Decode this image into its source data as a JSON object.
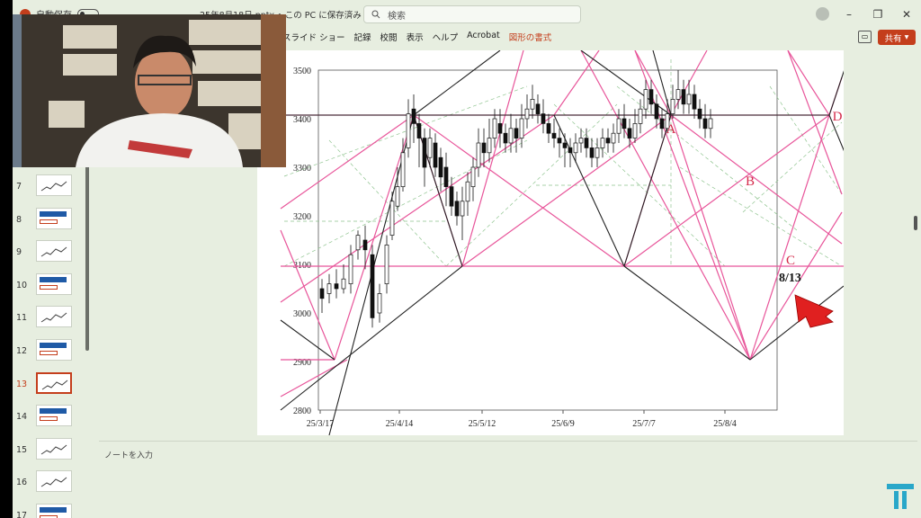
{
  "titlebar": {
    "autosave_label": "自動保存",
    "file_status": "25年8月18日.pptx • この PC に保存済み",
    "search_placeholder": "検索"
  },
  "ribbon": {
    "tabs": [
      "スライド ショー",
      "記録",
      "校閲",
      "表示",
      "ヘルプ",
      "Acrobat",
      "図形の書式"
    ],
    "active_tab": "図形の書式",
    "share_label": "共有"
  },
  "thumbnails": {
    "numbers": [
      "7",
      "8",
      "9",
      "10",
      "11",
      "12",
      "13",
      "14",
      "15",
      "16",
      "17"
    ],
    "selected": "13"
  },
  "notes": {
    "placeholder": "ノートを入力"
  },
  "chart_data": {
    "type": "candlestick",
    "x_tick_labels": [
      "25/3/17",
      "25/4/14",
      "25/5/12",
      "25/6/9",
      "25/7/7",
      "25/8/4"
    ],
    "y_tick_labels": [
      "2800",
      "2900",
      "3000",
      "3100",
      "3200",
      "3300",
      "3400",
      "3500"
    ],
    "ylim": [
      2800,
      3500
    ],
    "annotations": [
      "A",
      "B",
      "C",
      "D",
      "8/13"
    ],
    "grid_color": "#e8559a",
    "arrow_color": "#e02020"
  },
  "colors": {
    "accent": "#c43e1c",
    "magenta_lines": "#e0559a",
    "black_lines": "#222222"
  }
}
